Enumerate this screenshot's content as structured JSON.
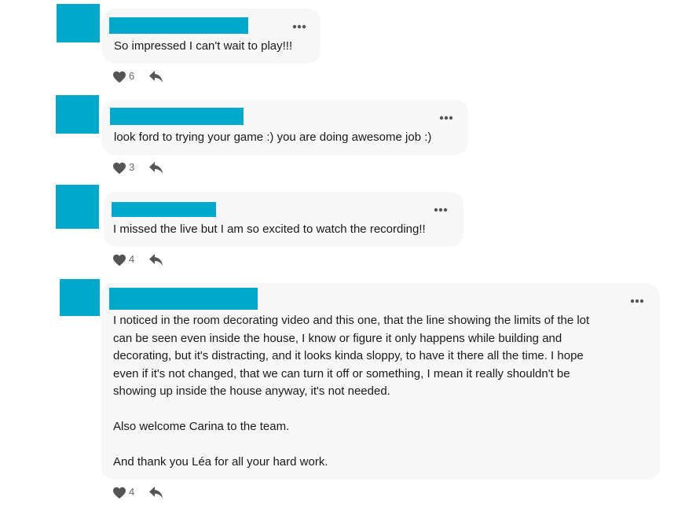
{
  "colors": {
    "avatar": "#00a8cc",
    "bubble": "#f7f7f7",
    "icon": "#555555"
  },
  "icons": {
    "more": "more-horizontal-icon",
    "like": "heart-icon",
    "reply": "reply-arrow-icon"
  },
  "comments": [
    {
      "text": "So impressed I can't wait to play!!!",
      "likes": "6"
    },
    {
      "text": "look ford to trying your game :) you are doing awesome job :)",
      "likes": "3"
    },
    {
      "text": "I missed the live but I am so excited to watch the recording!!",
      "likes": "4"
    },
    {
      "text": "I noticed in the room decorating video and this one, that the line showing the limits of the lot\ncan be seen even inside the house, I know or figure it only happens while building and\ndecorating, but it's distracting, and it looks kinda sloppy, to have it there all the time. I hope\neven if it's not changed, that we can turn it off or something, I mean it really shouldn't be\nshowing up inside the house anyway, it's not needed.\n\nAlso welcome Carina to the team.\n\nAnd thank you Léa for all your hard work.",
      "likes": "4"
    }
  ]
}
